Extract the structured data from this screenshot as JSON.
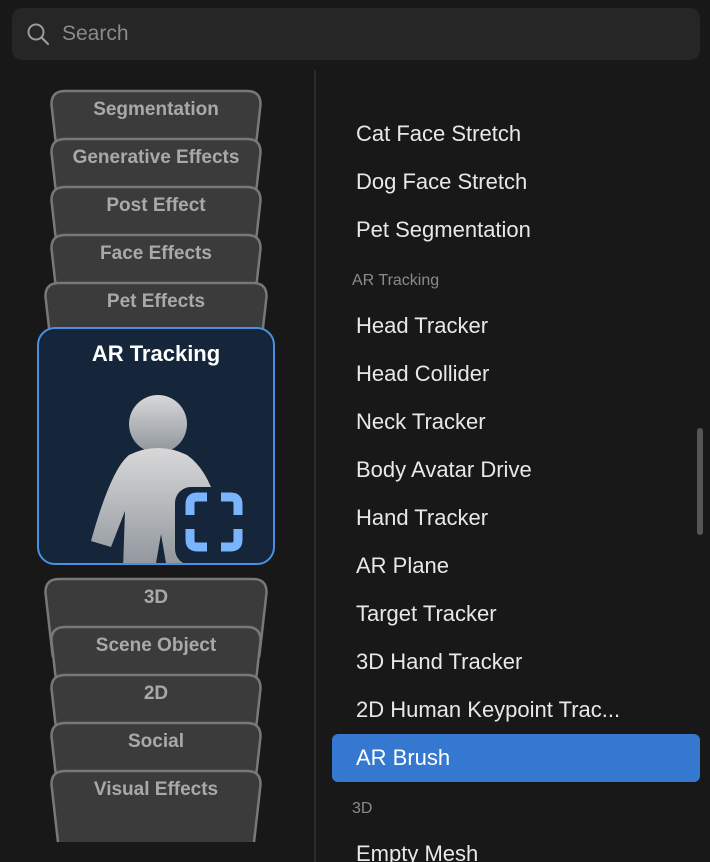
{
  "search": {
    "placeholder": "Search"
  },
  "categories": {
    "above": [
      "Segmentation",
      "Generative Effects",
      "Post Effect",
      "Face Effects",
      "Pet Effects"
    ],
    "active": "AR Tracking",
    "below": [
      "3D",
      "Scene Object",
      "2D",
      "Social",
      "Visual Effects"
    ]
  },
  "list": [
    {
      "type": "item",
      "label": "Cat Face Stretch"
    },
    {
      "type": "item",
      "label": "Dog Face Stretch"
    },
    {
      "type": "item",
      "label": "Pet Segmentation"
    },
    {
      "type": "header",
      "label": "AR Tracking"
    },
    {
      "type": "item",
      "label": "Head Tracker"
    },
    {
      "type": "item",
      "label": "Head Collider"
    },
    {
      "type": "item",
      "label": "Neck Tracker"
    },
    {
      "type": "item",
      "label": "Body Avatar Drive"
    },
    {
      "type": "item",
      "label": "Hand Tracker"
    },
    {
      "type": "item",
      "label": "AR Plane"
    },
    {
      "type": "item",
      "label": "Target Tracker"
    },
    {
      "type": "item",
      "label": "3D Hand Tracker"
    },
    {
      "type": "item",
      "label": "2D Human Keypoint Trac..."
    },
    {
      "type": "item",
      "label": "AR Brush",
      "selected": true
    },
    {
      "type": "header",
      "label": "3D"
    },
    {
      "type": "item",
      "label": "Empty Mesh"
    }
  ],
  "colors": {
    "accent": "#3478d0",
    "active_border": "#4a90e2",
    "active_bg": "#15253a"
  }
}
